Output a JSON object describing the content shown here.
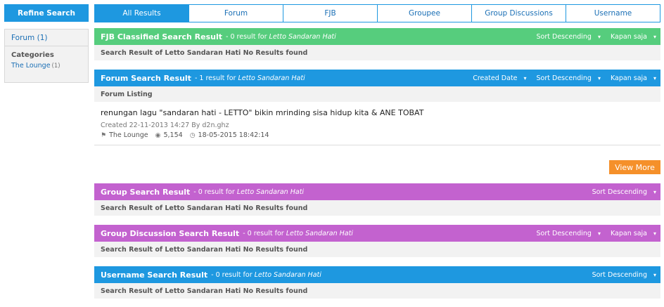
{
  "sidebar": {
    "refine_label": "Refine Search",
    "forum_filter": "Forum (1)",
    "categories_label": "Categories",
    "category_item": {
      "label": "The Lounge",
      "count": "(1)"
    }
  },
  "tabs": [
    {
      "label": "All Results",
      "active": true
    },
    {
      "label": "Forum"
    },
    {
      "label": "FJB"
    },
    {
      "label": "Groupee"
    },
    {
      "label": "Group Discussions"
    },
    {
      "label": "Username"
    }
  ],
  "query": "Letto Sandaran Hati",
  "colors": {
    "blue": "#1e98e0",
    "green": "#56cd7d",
    "purple": "#c362cf",
    "orange": "#f5902a"
  },
  "sections": {
    "fjb": {
      "title": "FJB Classified Search Result",
      "meta_prefix": "- 0 result for",
      "sort": "Sort Descending",
      "time": "Kapan saja",
      "no_results": "Search Result of Letto Sandaran Hati No Results found"
    },
    "forum": {
      "title": "Forum Search Result",
      "meta_prefix": "- 1 result for",
      "created_date": "Created Date",
      "sort": "Sort Descending",
      "time": "Kapan saja",
      "listing_label": "Forum Listing",
      "result": {
        "title": "renungan lagu \"sandaran hati - LETTO\" bikin mrinding sisa hidup kita & ANE TOBAT",
        "created": "Created 22-11-2013 14:27 By d2n.ghz",
        "category": "The Lounge",
        "views": "5,154",
        "last_post": "18-05-2015 18:42:14"
      },
      "view_more": "View More"
    },
    "group": {
      "title": "Group Search Result",
      "meta_prefix": "- 0 result for",
      "sort": "Sort Descending",
      "no_results": "Search Result of Letto Sandaran Hati No Results found"
    },
    "group_discussion": {
      "title": "Group Discussion Search Result",
      "meta_prefix": "- 0 result for",
      "sort": "Sort Descending",
      "time": "Kapan saja",
      "no_results": "Search Result of Letto Sandaran Hati No Results found"
    },
    "username": {
      "title": "Username Search Result",
      "meta_prefix": "- 0 result for",
      "sort": "Sort Descending",
      "no_results": "Search Result of Letto Sandaran Hati No Results found"
    }
  }
}
